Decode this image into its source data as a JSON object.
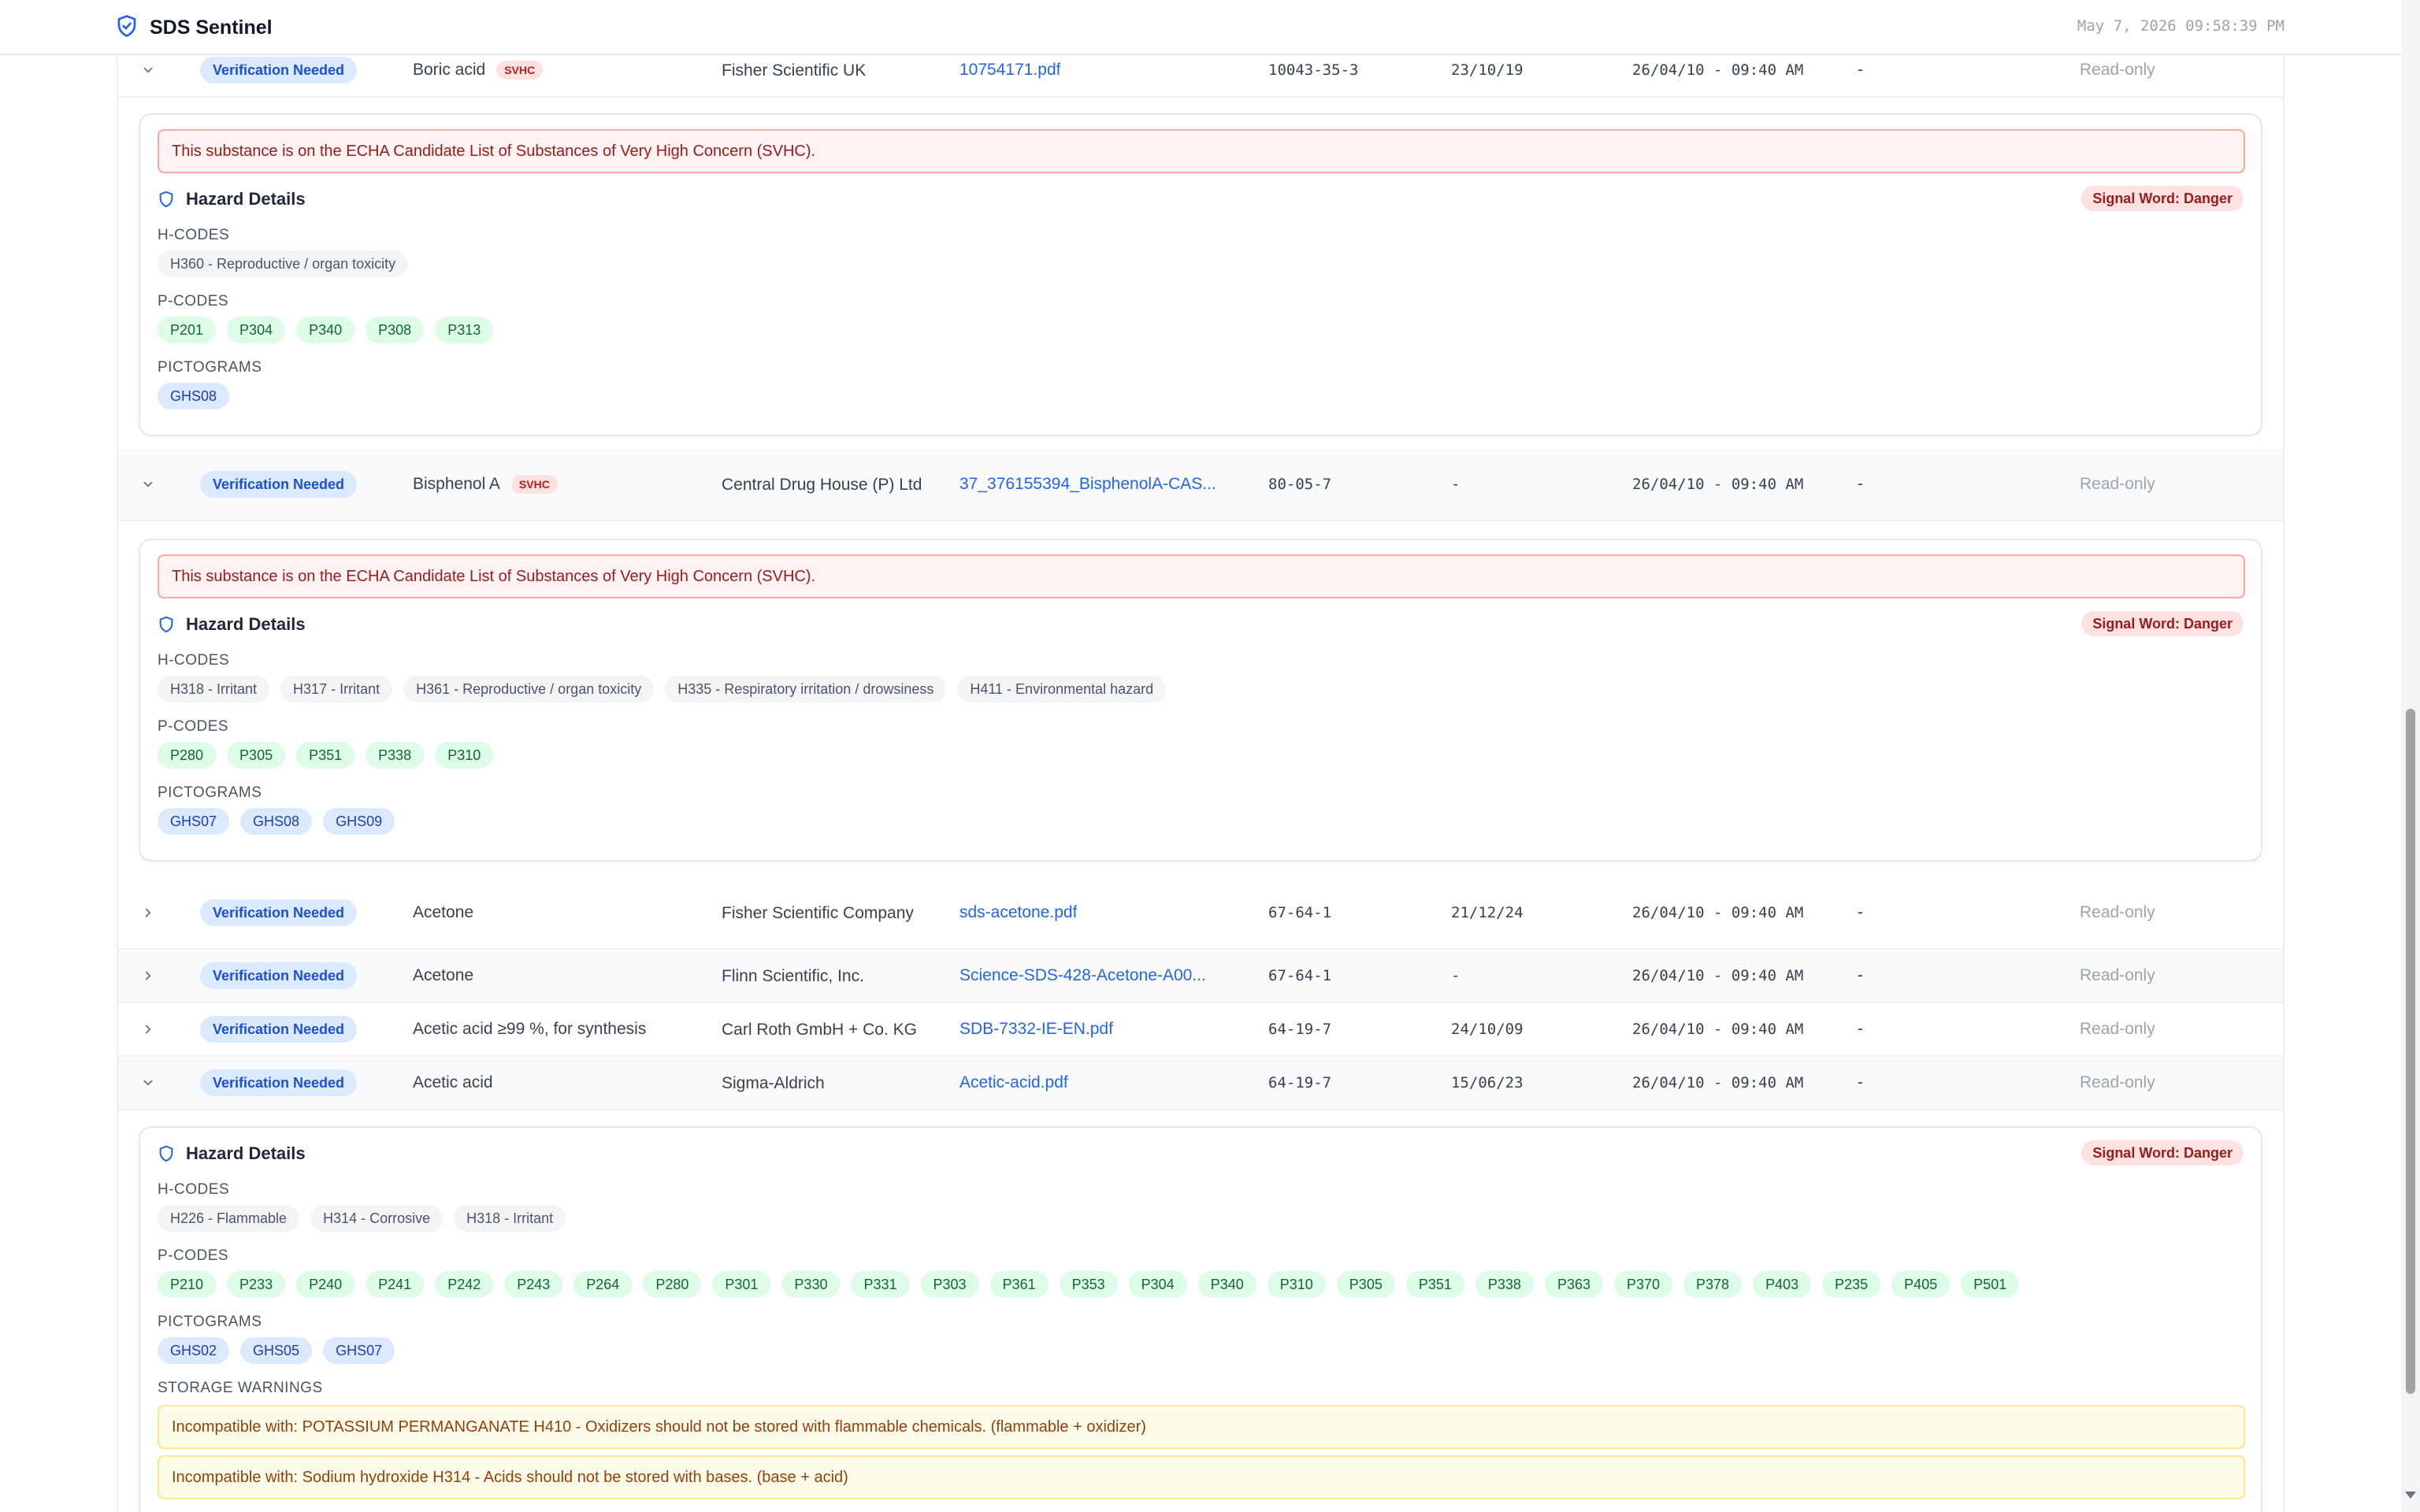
{
  "header": {
    "app_title": "SDS Sentinel",
    "timestamp": "May 7, 2026 09:58:39 PM"
  },
  "rows": [
    {
      "expanded": true,
      "status": "Verification Needed",
      "product": "Boric acid",
      "svhc": "SVHC",
      "supplier": "Fisher Scientific UK",
      "file": "10754171.pdf",
      "cas": "10043-35-3",
      "revision": "23/10/19",
      "updated": "26/04/10 - 09:40 AM",
      "owner": "-",
      "access": "Read-only"
    },
    {
      "expanded": true,
      "status": "Verification Needed",
      "product": "Bisphenol A",
      "svhc": "SVHC",
      "supplier": "Central Drug House (P) Ltd",
      "file": "37_376155394_BisphenolA-CAS...",
      "cas": "80-05-7",
      "revision": "-",
      "updated": "26/04/10 - 09:40 AM",
      "owner": "-",
      "access": "Read-only"
    },
    {
      "expanded": false,
      "status": "Verification Needed",
      "product": "Acetone",
      "svhc": "",
      "supplier": "Fisher Scientific Company",
      "file": "sds-acetone.pdf",
      "cas": "67-64-1",
      "revision": "21/12/24",
      "updated": "26/04/10 - 09:40 AM",
      "owner": "-",
      "access": "Read-only"
    },
    {
      "expanded": false,
      "status": "Verification Needed",
      "product": "Acetone",
      "svhc": "",
      "supplier": "Flinn Scientific, Inc.",
      "file": "Science-SDS-428-Acetone-A00...",
      "cas": "67-64-1",
      "revision": "-",
      "updated": "26/04/10 - 09:40 AM",
      "owner": "-",
      "access": "Read-only"
    },
    {
      "expanded": false,
      "status": "Verification Needed",
      "product": "Acetic acid ≥99 %, for synthesis",
      "svhc": "",
      "supplier": "Carl Roth GmbH + Co. KG",
      "file": "SDB-7332-IE-EN.pdf",
      "cas": "64-19-7",
      "revision": "24/10/09",
      "updated": "26/04/10 - 09:40 AM",
      "owner": "-",
      "access": "Read-only"
    },
    {
      "expanded": true,
      "status": "Verification Needed",
      "product": "Acetic acid",
      "svhc": "",
      "supplier": "Sigma-Aldrich",
      "file": "Acetic-acid.pdf",
      "cas": "64-19-7",
      "revision": "15/06/23",
      "updated": "26/04/10 - 09:40 AM",
      "owner": "-",
      "access": "Read-only"
    }
  ],
  "panels": [
    {
      "svhc_alert": "This substance is on the ECHA Candidate List of Substances of Very High Concern (SVHC).",
      "title": "Hazard Details",
      "signal": "Signal Word: Danger",
      "h_label": "H-CODES",
      "h_codes": [
        "H360 - Reproductive / organ toxicity"
      ],
      "p_label": "P-CODES",
      "p_codes": [
        "P201",
        "P304",
        "P340",
        "P308",
        "P313"
      ],
      "g_label": "PICTOGRAMS",
      "pictograms": [
        "GHS08"
      ]
    },
    {
      "svhc_alert": "This substance is on the ECHA Candidate List of Substances of Very High Concern (SVHC).",
      "title": "Hazard Details",
      "signal": "Signal Word: Danger",
      "h_label": "H-CODES",
      "h_codes": [
        "H318 - Irritant",
        "H317 - Irritant",
        "H361 - Reproductive / organ toxicity",
        "H335 - Respiratory irritation / drowsiness",
        "H411 - Environmental hazard"
      ],
      "p_label": "P-CODES",
      "p_codes": [
        "P280",
        "P305",
        "P351",
        "P338",
        "P310"
      ],
      "g_label": "PICTOGRAMS",
      "pictograms": [
        "GHS07",
        "GHS08",
        "GHS09"
      ]
    },
    {
      "svhc_alert": "",
      "title": "Hazard Details",
      "signal": "Signal Word: Danger",
      "h_label": "H-CODES",
      "h_codes": [
        "H226 - Flammable",
        "H314 - Corrosive",
        "H318 - Irritant"
      ],
      "p_label": "P-CODES",
      "p_codes": [
        "P210",
        "P233",
        "P240",
        "P241",
        "P242",
        "P243",
        "P264",
        "P280",
        "P301",
        "P330",
        "P331",
        "P303",
        "P361",
        "P353",
        "P304",
        "P340",
        "P310",
        "P305",
        "P351",
        "P338",
        "P363",
        "P370",
        "P378",
        "P403",
        "P235",
        "P405",
        "P501"
      ],
      "g_label": "PICTOGRAMS",
      "pictograms": [
        "GHS02",
        "GHS05",
        "GHS07"
      ],
      "storage_label": "STORAGE WARNINGS",
      "storage_warnings": [
        "Incompatible with: POTASSIUM PERMANGANATE H410 - Oxidizers should not be stored with flammable chemicals. (flammable + oxidizer)",
        "Incompatible with: Sodium hydroxide H314 - Acids should not be stored with bases. (base + acid)"
      ]
    }
  ]
}
